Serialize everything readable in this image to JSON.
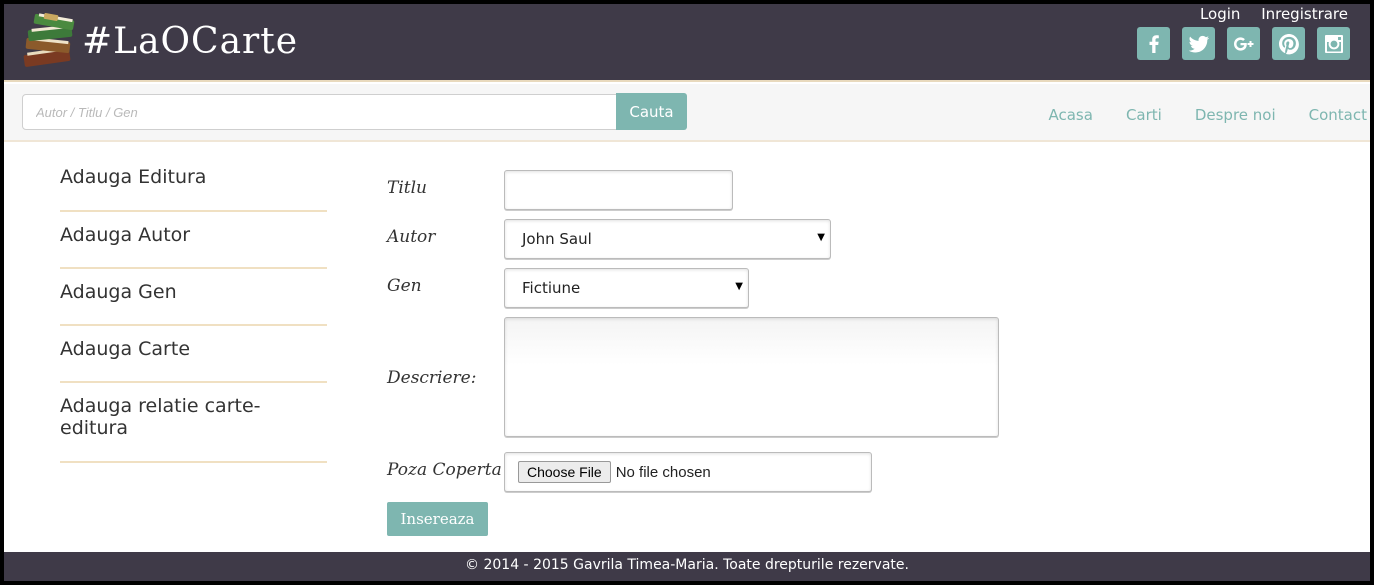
{
  "brand": "#LaOCarte",
  "top_links": {
    "login": "Login",
    "register": "Inregistrare"
  },
  "social_icons": [
    "facebook-icon",
    "twitter-icon",
    "google-plus-icon",
    "pinterest-icon",
    "instagram-icon"
  ],
  "search": {
    "placeholder": "Autor / Titlu / Gen",
    "button_label": "Cauta"
  },
  "nav": {
    "home": "Acasa",
    "books": "Carti",
    "about": "Despre noi",
    "contact": "Contact"
  },
  "sidebar": {
    "items": [
      {
        "label": "Adauga Editura"
      },
      {
        "label": "Adauga Autor"
      },
      {
        "label": "Adauga Gen"
      },
      {
        "label": "Adauga Carte"
      },
      {
        "label": "Adauga relatie carte-editura"
      }
    ]
  },
  "form": {
    "title_label": "Titlu",
    "title_value": "",
    "author_label": "Autor",
    "author_selected": "John Saul",
    "genre_label": "Gen",
    "genre_selected": "Fictiune",
    "description_label": "Descriere:",
    "cover_label": "Poza Coperta",
    "choose_file_label": "Choose File",
    "no_file_text": "No file chosen",
    "submit_label": "Insereaza"
  },
  "footer": {
    "text": "© 2014 - 2015 Gavrila Timea-Maria. Toate drepturile rezervate."
  },
  "colors": {
    "header_bg": "#3f3a48",
    "accent": "#7eb6b0",
    "divider": "#f0e0c2"
  }
}
